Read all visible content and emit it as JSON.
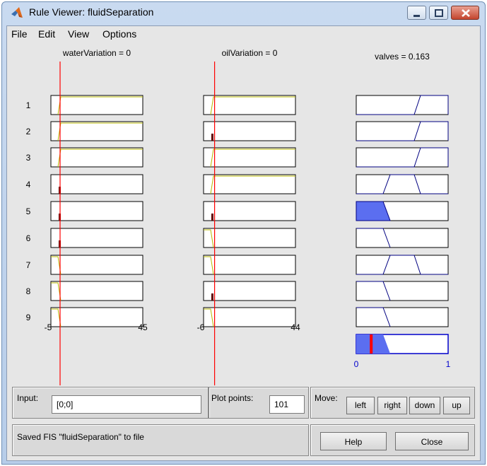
{
  "window": {
    "title": "Rule Viewer: fluidSeparation"
  },
  "menu": [
    "File",
    "Edit",
    "View",
    "Options"
  ],
  "inputs": [
    {
      "header": "waterVariation = 0",
      "range_min": "-5",
      "range_max": "45",
      "value": 0,
      "min": -5,
      "max": 45
    },
    {
      "header": "oilVariation = 0",
      "range_min": "-6",
      "range_max": "44",
      "value": 0,
      "min": -6,
      "max": 44
    }
  ],
  "output": {
    "header": "valves = 0.163",
    "range_min": "0",
    "range_max": "1",
    "value": 0.163
  },
  "rules": [
    "1",
    "2",
    "3",
    "4",
    "5",
    "6",
    "7",
    "8",
    "9"
  ],
  "controls": {
    "input_label": "Input:",
    "input_value": "[0;0]",
    "plot_points_label": "Plot points:",
    "plot_points_value": "101",
    "move_label": "Move:",
    "move_buttons": [
      "left",
      "right",
      "down",
      "up"
    ],
    "status": "Saved FIS \"fluidSeparation\" to file",
    "help_label": "Help",
    "close_label": "Close"
  },
  "colors": {
    "active_fill": "#5b6ef0",
    "indicator": "#ff0000",
    "mf_line": "#b8b800",
    "output_line": "#000080"
  }
}
